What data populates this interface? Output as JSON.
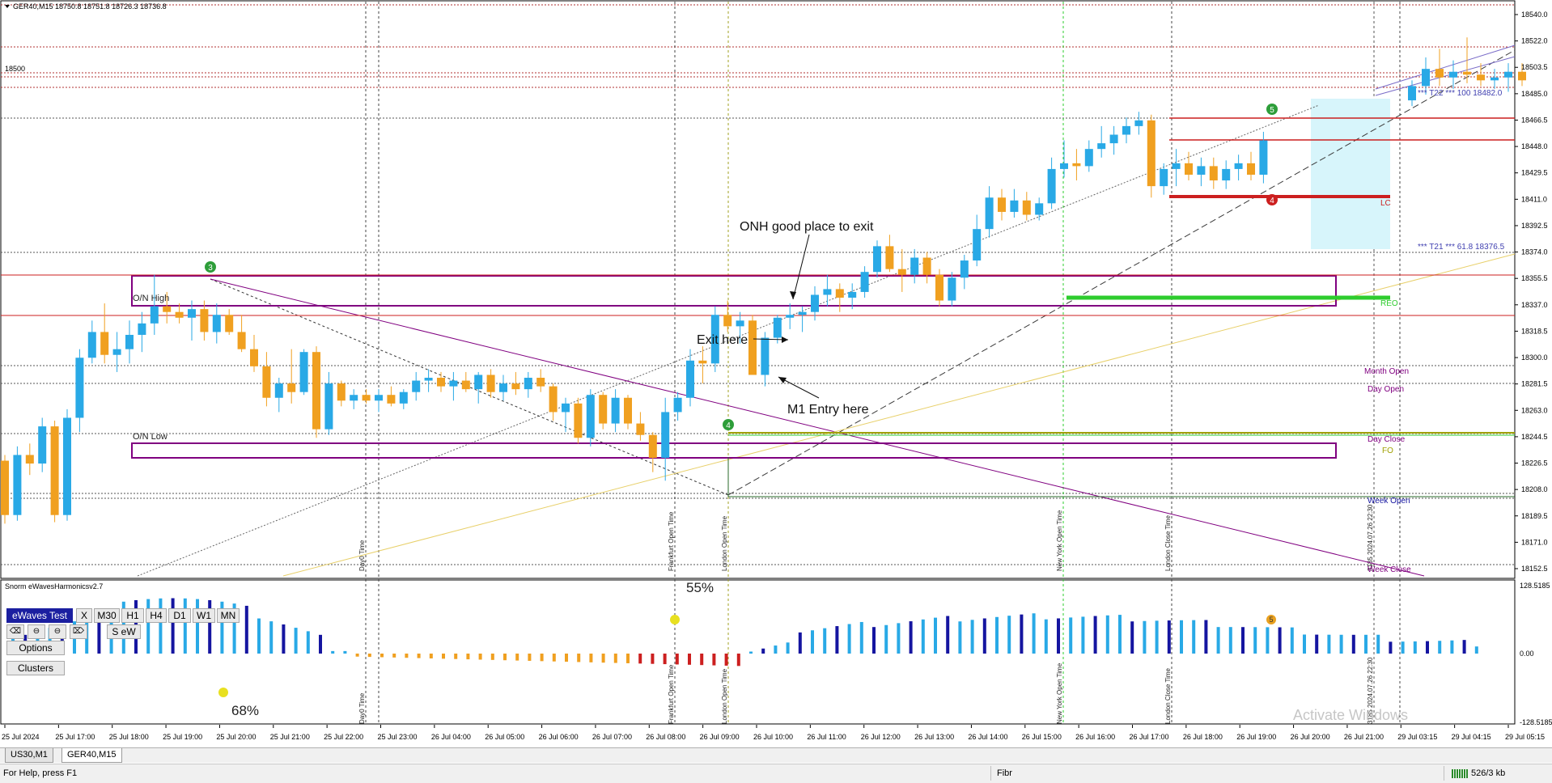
{
  "window": {
    "symbol_header": "GER40,M15  18750.8 18751.8 18726.3 18736.8",
    "indicator_name": "Snorm eWavesHarmonicsv2.7"
  },
  "price_axis": {
    "ticks": [
      "18540.0",
      "18522.0",
      "18503.5",
      "18485.0",
      "18466.5",
      "18448.0",
      "18429.5",
      "18411.0",
      "18392.5",
      "18374.0",
      "18355.5",
      "18337.0",
      "18318.5",
      "18300.0",
      "18281.5",
      "18263.0",
      "18244.5",
      "18226.5",
      "18208.0",
      "18189.5",
      "18171.0",
      "18152.5"
    ],
    "left_label": "18500"
  },
  "indicator_axis": {
    "ticks": [
      "128.5185",
      "0.00",
      "-128.5185"
    ]
  },
  "time_axis": {
    "ticks": [
      "25 Jul 2024",
      "25 Jul 17:00",
      "25 Jul 18:00",
      "25 Jul 19:00",
      "25 Jul 20:00",
      "25 Jul 21:00",
      "25 Jul 22:00",
      "25 Jul 23:00",
      "26 Jul 04:00",
      "26 Jul 05:00",
      "26 Jul 06:00",
      "26 Jul 07:00",
      "26 Jul 08:00",
      "26 Jul 09:00",
      "26 Jul 10:00",
      "26 Jul 11:00",
      "26 Jul 12:00",
      "26 Jul 13:00",
      "26 Jul 14:00",
      "26 Jul 15:00",
      "26 Jul 16:00",
      "26 Jul 17:00",
      "26 Jul 18:00",
      "26 Jul 19:00",
      "26 Jul 20:00",
      "26 Jul 21:00",
      "29 Jul 03:15",
      "29 Jul 04:15",
      "29 Jul 05:15"
    ]
  },
  "session_labels": {
    "day0": "Day0 Time",
    "frankfurt": "Frankfurt Open Time",
    "london_open": "London Open Time",
    "new_york": "New York Open Time",
    "london_close": "London Close Time",
    "bar_time": "3185 2024.07.26 22:30"
  },
  "annotations": {
    "onh_exit": "ONH good place to exit",
    "exit_here": "Exit here",
    "m1_entry": "M1 Entry here",
    "on_high": "O/N High",
    "on_low": "O/N Low",
    "pct_55": "55%",
    "pct_68": "68%",
    "watermark": "Activate Windows"
  },
  "wave_labels": {
    "w3": "3",
    "w4": "4",
    "w5": "5",
    "w4b": "4"
  },
  "level_labels": {
    "t22": "*** T22 *** 100  18482.0",
    "t21": "*** T21 *** 61.8  18376.5",
    "lc": "LC",
    "reo": "REO",
    "month_open": "Month Open",
    "day_open": "Day Open",
    "day_close": "Day Close",
    "fo": "FO",
    "week_open": "Week Open",
    "week_close": "Week Close"
  },
  "indicator_panel": {
    "title_button": "eWaves Test",
    "tf_buttons": [
      "X",
      "M30",
      "H1",
      "H4",
      "D1",
      "W1",
      "MN"
    ],
    "seW": "S eW",
    "options": "Options",
    "clusters": "Clusters"
  },
  "tabs": [
    "US30,M1",
    "GER40,M15"
  ],
  "status": {
    "help": "For Help, press F1",
    "profile": "Fibr",
    "traffic": "526/3 kb"
  },
  "colors": {
    "bull": "#29a9e6",
    "bear": "#f0a020",
    "red_level": "#cc1f1f",
    "green_level": "#2ecc2e",
    "purple": "#800080",
    "dark_blue": "#1515a0",
    "cyan_box": "#d7f5fb",
    "yellow_line": "#e8d06a"
  },
  "chart_data": {
    "type": "candlestick",
    "series": [
      {
        "name": "GER40,M15",
        "ohlc": [
          [
            18228,
            18232,
            18184,
            18190
          ],
          [
            18190,
            18238,
            18186,
            18232
          ],
          [
            18232,
            18240,
            18218,
            18226
          ],
          [
            18226,
            18258,
            18220,
            18252
          ],
          [
            18252,
            18256,
            18185,
            18190
          ],
          [
            18190,
            18264,
            18186,
            18258
          ],
          [
            18258,
            18306,
            18248,
            18300
          ],
          [
            18300,
            18326,
            18296,
            18318
          ],
          [
            18318,
            18338,
            18296,
            18302
          ],
          [
            18302,
            18318,
            18290,
            18306
          ],
          [
            18306,
            18326,
            18296,
            18316
          ],
          [
            18316,
            18332,
            18304,
            18324
          ],
          [
            18324,
            18358,
            18316,
            18336
          ],
          [
            18336,
            18346,
            18324,
            18332
          ],
          [
            18332,
            18338,
            18324,
            18328
          ],
          [
            18328,
            18340,
            18312,
            18334
          ],
          [
            18334,
            18340,
            18312,
            18318
          ],
          [
            18318,
            18338,
            18310,
            18330
          ],
          [
            18330,
            18334,
            18316,
            18318
          ],
          [
            18318,
            18330,
            18304,
            18306
          ],
          [
            18306,
            18316,
            18290,
            18294
          ],
          [
            18294,
            18304,
            18266,
            18272
          ],
          [
            18272,
            18286,
            18262,
            18282
          ],
          [
            18282,
            18306,
            18268,
            18276
          ],
          [
            18276,
            18306,
            18274,
            18304
          ],
          [
            18304,
            18308,
            18244,
            18250
          ],
          [
            18250,
            18290,
            18246,
            18282
          ],
          [
            18282,
            18284,
            18266,
            18270
          ],
          [
            18270,
            18278,
            18264,
            18274
          ],
          [
            18274,
            18278,
            18268,
            18270
          ],
          [
            18270,
            18278,
            18262,
            18274
          ],
          [
            18274,
            18280,
            18266,
            18268
          ],
          [
            18268,
            18278,
            18264,
            18276
          ],
          [
            18276,
            18290,
            18270,
            18284
          ],
          [
            18284,
            18292,
            18276,
            18286
          ],
          [
            18286,
            18290,
            18276,
            18280
          ],
          [
            18280,
            18290,
            18270,
            18284
          ],
          [
            18284,
            18290,
            18276,
            18278
          ],
          [
            18278,
            18290,
            18268,
            18288
          ],
          [
            18288,
            18292,
            18272,
            18276
          ],
          [
            18276,
            18288,
            18270,
            18282
          ],
          [
            18282,
            18290,
            18274,
            18278
          ],
          [
            18278,
            18290,
            18272,
            18286
          ],
          [
            18286,
            18292,
            18276,
            18280
          ],
          [
            18280,
            18282,
            18256,
            18262
          ],
          [
            18262,
            18272,
            18248,
            18268
          ],
          [
            18268,
            18272,
            18240,
            18244
          ],
          [
            18244,
            18278,
            18238,
            18274
          ],
          [
            18274,
            18276,
            18250,
            18254
          ],
          [
            18254,
            18278,
            18248,
            18272
          ],
          [
            18272,
            18274,
            18250,
            18254
          ],
          [
            18254,
            18262,
            18242,
            18246
          ],
          [
            18246,
            18248,
            18220,
            18230
          ],
          [
            18230,
            18272,
            18214,
            18262
          ],
          [
            18262,
            18276,
            18256,
            18272
          ],
          [
            18272,
            18306,
            18266,
            18298
          ],
          [
            18298,
            18308,
            18282,
            18296
          ],
          [
            18296,
            18336,
            18290,
            18330
          ],
          [
            18330,
            18340,
            18318,
            18322
          ],
          [
            18322,
            18332,
            18310,
            18326
          ],
          [
            18326,
            18330,
            18296,
            18288
          ],
          [
            18288,
            18318,
            18280,
            18314
          ],
          [
            18314,
            18330,
            18310,
            18328
          ],
          [
            18328,
            18338,
            18320,
            18330
          ],
          [
            18330,
            18336,
            18318,
            18332
          ],
          [
            18332,
            18350,
            18326,
            18344
          ],
          [
            18344,
            18358,
            18336,
            18348
          ],
          [
            18348,
            18352,
            18332,
            18342
          ],
          [
            18342,
            18352,
            18334,
            18346
          ],
          [
            18346,
            18364,
            18342,
            18360
          ],
          [
            18360,
            18382,
            18356,
            18378
          ],
          [
            18378,
            18386,
            18360,
            18362
          ],
          [
            18362,
            18376,
            18346,
            18358
          ],
          [
            18358,
            18376,
            18352,
            18370
          ],
          [
            18370,
            18374,
            18352,
            18358
          ],
          [
            18358,
            18362,
            18336,
            18340
          ],
          [
            18340,
            18360,
            18336,
            18356
          ],
          [
            18356,
            18372,
            18348,
            18368
          ],
          [
            18368,
            18400,
            18364,
            18390
          ],
          [
            18390,
            18420,
            18384,
            18412
          ],
          [
            18412,
            18418,
            18396,
            18402
          ],
          [
            18402,
            18418,
            18398,
            18410
          ],
          [
            18410,
            18416,
            18396,
            18400
          ],
          [
            18400,
            18412,
            18396,
            18408
          ],
          [
            18408,
            18440,
            18404,
            18432
          ],
          [
            18432,
            18452,
            18426,
            18436
          ],
          [
            18436,
            18446,
            18424,
            18434
          ],
          [
            18434,
            18452,
            18430,
            18446
          ],
          [
            18446,
            18462,
            18440,
            18450
          ],
          [
            18450,
            18462,
            18442,
            18456
          ],
          [
            18456,
            18468,
            18450,
            18462
          ],
          [
            18462,
            18472,
            18456,
            18466
          ],
          [
            18466,
            18470,
            18412,
            18420
          ],
          [
            18420,
            18436,
            18414,
            18432
          ],
          [
            18432,
            18446,
            18420,
            18436
          ],
          [
            18436,
            18444,
            18424,
            18428
          ],
          [
            18428,
            18440,
            18420,
            18434
          ],
          [
            18434,
            18440,
            18418,
            18424
          ],
          [
            18424,
            18438,
            18418,
            18432
          ],
          [
            18432,
            18442,
            18424,
            18436
          ],
          [
            18436,
            18444,
            18424,
            18428
          ],
          [
            18428,
            18458,
            18422,
            18452
          ],
          [
            18480,
            18494,
            18476,
            18490
          ],
          [
            18490,
            18510,
            18484,
            18502
          ],
          [
            18502,
            18516,
            18490,
            18496
          ],
          [
            18496,
            18508,
            18488,
            18500
          ],
          [
            18500,
            18524,
            18492,
            18498
          ],
          [
            18498,
            18506,
            18490,
            18494
          ],
          [
            18494,
            18502,
            18488,
            18496
          ],
          [
            18496,
            18506,
            18486,
            18500
          ],
          [
            18500,
            18506,
            18490,
            18494
          ]
        ]
      }
    ],
    "indicator": {
      "name": "Snorm eWavesHarmonicsv2.7",
      "ylim": [
        -128.5185,
        128.5185
      ]
    }
  }
}
